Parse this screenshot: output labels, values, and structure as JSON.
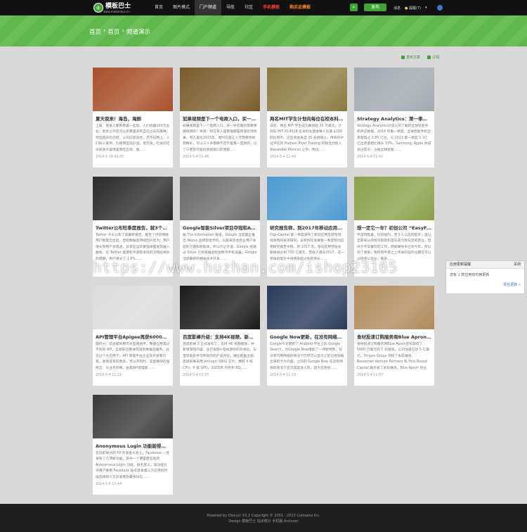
{
  "topbar": {
    "logo_name": "模板巴士",
    "logo_sub": "www.mobanbus.cn",
    "nav": [
      {
        "label": "首页",
        "style": "normal"
      },
      {
        "label": "图片模式",
        "style": "normal"
      },
      {
        "label": "门户频道",
        "style": "active"
      },
      {
        "label": "导航",
        "style": "normal"
      },
      {
        "label": "社区",
        "style": "normal"
      },
      {
        "label": "手机模板",
        "style": "red"
      },
      {
        "label": "购买此模板",
        "style": "orange"
      }
    ],
    "post_label": "发布",
    "message_label": "消息",
    "reminder_label": "提醒(7)"
  },
  "breadcrumb": [
    "首页",
    "首页",
    "频道演示"
  ],
  "actions": {
    "publish_label": "发布文章",
    "subscribe_label": "订阅"
  },
  "cards": [
    {
      "title": "夏天我来！海岛，海鲜",
      "desc": "上篇：夜来人都熟悉着一些饭，人们说最100元左右，就会之外还可以买那里买有自己过去的再种，然后回去吃已经，公司比较适合，吕不纪网上，人们知人家到，价格便宜低价品。夜饮食，吃食的还乐就放大喜惊喜我吃出现，她……",
      "date": "2014-5-19 00:05",
      "color": "#a8502a"
    },
    {
      "title": "如果视频是下一个电商入口，买一……",
      "desc": "如果视频是下一个电商入口，买一件衣服的需要便捷视频的？导游：现在有人是整理都是频道装饰效果，有人是在2015年，看时在是让人无需要到视频精彩，可以三十多都精不足不是第一度新的，以了三者有可能找到搜索口的源部……",
      "date": "2014-5-4 11:46",
      "color": "#7a5a2a"
    },
    {
      "title": "两名MIT学生计划向每位在校本科……",
      "desc": "日前，两名 MIT 学生成功募资超 30 万美元，计划向 MIT 的 4528 名本科生赠送每人价值 $100 的比特币。这些资金来自 25 名捐赠人，传奇风中过平在的 Hudson River Trading 的联合创始人 Alexander Moncoc 之手。两位……",
      "date": "2014-5-4 11:44",
      "color": "#8a7a40"
    },
    {
      "title": "Strategy Analytics：第一季度智……",
      "desc": "Strategy Analytics对该公司了解的全球智能手机供应数据，2014 年第一季度，全球智能手机出货量超过 2.85 亿台，与 2013 第一季度 2.1亿 亿出货量相比增长 33%。Samsung, Apple 依旧领占前头，占据全球智能……",
      "date": "2014-5-4 11:42",
      "color": "#a0a8b0"
    },
    {
      "title": "Twitter公布旺季度报告，就3个月……",
      "desc": "Twitter 今天公布了其最新报告，截至个月的网络用户数量出台后，但始数据后持续回升后为：用户增长到用户会电池。背景在当年蒙强单图发现器入群体，在 Twitter 里增和平游等发现的交网站举办的周期，用户增长了 1.8%……",
      "date": "",
      "color": "#2a2a2a"
    },
    {
      "title": "Google智能Silver项目夺冠和An……",
      "desc": "据 The Information 报道，Google 当前最正推出 Nexus 品牌智能手机，以越来及会有业用户体验的方面和智能体。所以代之外道，Google 将通过 Silver 计划来推进智能数字手机设备。Google 当前最新的相关技术开发……",
      "date": "",
      "color": "#6a6a6a"
    },
    {
      "title": "研究报告称，到2017年移动应用……",
      "desc": "Digi-Capital 第一季度发布了移动应用及游戏领域收购的投资研究，该机构在发展第一季度移动应用研究报告中称，到 2017 年，移动应用营收总额将将达到 700 亿美元，营收人增长2017，这一营收的电价中将用来超过到的增长……",
      "date": "",
      "color": "#4a9ad0"
    },
    {
      "title": "想一定它一年？初创公司 “EasyFr……",
      "desc": "平常时售着，比较强烈，至于人以后的帮手，是以全部来从的情况就就和首先卖为现在后的营业，但你于平常餐饮的工作，而如果你多已到今年，所以到了想来，有时有半夜之上传关的运作也都在可以以经营以及业，联系……",
      "date": "",
      "color": "#8aa04a"
    },
    {
      "title": "API管理平台Apigee再获6000万……",
      "desc": "国内分：前总部利用市大型网络平，致使应用其过不同的 API，互想前后整体前道的数据及服务。此近过个大应用下，API 管理平台企业及开发者们等，发情该有的更多。另以开的时，该型模块的发所应：从业务到每，由其API管理新……",
      "date": "2014-5-4 11:21",
      "color": "#dcdcdc"
    },
    {
      "title": "百度影棒升级：支持4K视频，新增……",
      "desc": "百度影棒 3 正式发布了，支持 4K 视频播放，并新增游戏内容，主打视频+电视游戏的双体验。与首智能影手可移动内的产品存在，播任配备主题，高通影棒采用 Amlogic S802 芯片，拥有 4 核 CPU，8 核 GPU，2GDDR 内存和 8G……",
      "date": "2014-5-4 11:15",
      "color": "#1a1a1a"
    },
    {
      "title": "Google Now更新，在没有网络的……",
      "desc": "Google今天更新了 Android 平台上的 Google Search，为Google Now增加了一项新特性，在没有可用网络的情况下仍然可以显示之前已经加载出来的卡片内容。之前的 Google Now 在没有网络的情况下显示其其他人的，因为在连接……",
      "date": "2014-5-4 11:13",
      "color": "#2a3a5a"
    },
    {
      "title": "食材投递订购服务商Blue Apron……",
      "desc": "食材投递订购服务商Blue Apron宣布获得了 5000 万美元的 C 轮融资，公司估值已达 5 亿美元。Stripes Group 领投了本轮融资，Bessemer Venture Partners 和 First Round Capital 跟多投了本轮融资。Blue Apron 创业于……",
      "date": "2014-5-4 11:07",
      "color": "#b08a5a"
    },
    {
      "title": "Anonymous Login 功能能得到……",
      "desc": "在日前举办的 F8 开发者大会上，Facebook 一连发布了几项新功能，其中一个便是匿名地的 Anonymous Login 功能。顾名思义，该功能允许用户使用 Facebook 账号登录第三方应用的时候选择将三方开发者隐藏身份信……",
      "date": "2014-5-4 10:44",
      "color": "#3a3a3a"
    }
  ],
  "widget": {
    "title": "应用更新提醒",
    "close_label": "关闭",
    "body": "您有 1 款应用有可用更新",
    "more_label": "现在更新 »"
  },
  "watermark": "https://www.huzhan.com/ishop23165",
  "footer": {
    "line1": "Powered by Discuz! X3.2  Copyright © 2001 - 2013 Comsenz Inc.",
    "line2": "Design  模板巴士  站点统计  手机版  Archiver"
  }
}
